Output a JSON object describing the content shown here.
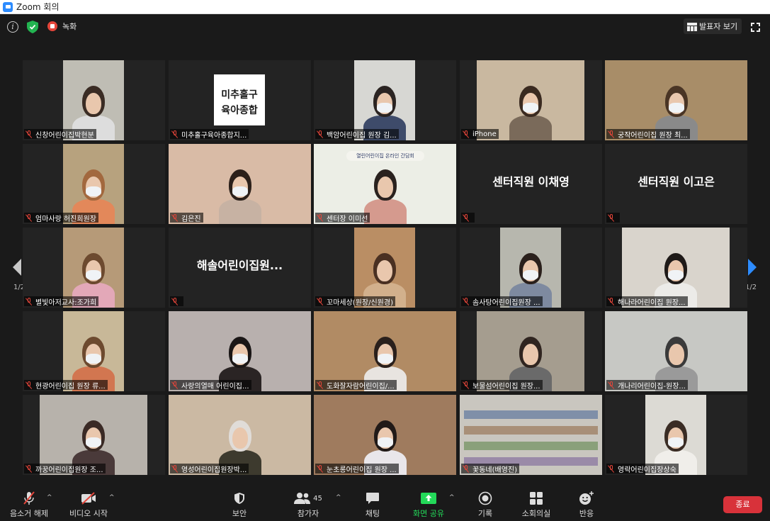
{
  "window": {
    "title": "Zoom 회의"
  },
  "topbar": {
    "recording_label": "녹화",
    "view_button_label": "발표자 보기"
  },
  "gallery": {
    "page_indicator_left": "1/2",
    "page_indicator_right": "1/2",
    "tiles": [
      {
        "name": "신창어린이집박현분"
      },
      {
        "name": "미추홀구육아종합지..."
      },
      {
        "name": "백암어린이집 원장 김..."
      },
      {
        "name": "iPhone"
      },
      {
        "name": "궁작어린이집 원장 최..."
      },
      {
        "name": "엄마사랑 허진희원장"
      },
      {
        "name": "김은진"
      },
      {
        "name": "센터장 이미선"
      },
      {
        "name": "",
        "display_name": "센터직원 이채영"
      },
      {
        "name": "",
        "display_name": "센터직원 이고은"
      },
      {
        "name": "별빛아저교사:조가희"
      },
      {
        "name": "",
        "display_name": "해솔어린이집원..."
      },
      {
        "name": "꼬마세상(원장/신원경)"
      },
      {
        "name": "솜사탕어린이집원장 ..."
      },
      {
        "name": "해나라어린이집 원장..."
      },
      {
        "name": "현광어린이집 원장 류..."
      },
      {
        "name": "사랑의열매 어린이집..."
      },
      {
        "name": "도화잘자람어린이집/..."
      },
      {
        "name": "보물섬어린이집 원장..."
      },
      {
        "name": "개나리어린이집-원장..."
      },
      {
        "name": "까꿍어린이집원장 조..."
      },
      {
        "name": "영성어린이집원장박..."
      },
      {
        "name": "눈초롱어린이집 원장 ..."
      },
      {
        "name": "꽃동네(배영진)"
      },
      {
        "name": "영락어린이집장상숙"
      }
    ],
    "logo_lines": [
      "미추홀구",
      "육아종합"
    ],
    "banner_text": "열린어린이집 온라인 간담회"
  },
  "toolbar": {
    "unmute_label": "음소거 해제",
    "start_video_label": "비디오 시작",
    "security_label": "보안",
    "participants_label": "참가자",
    "participants_count": "45",
    "chat_label": "채팅",
    "share_label": "화면 공유",
    "record_label": "기록",
    "breakout_label": "소회의실",
    "reactions_label": "반응",
    "end_label": "종료"
  },
  "colors": {
    "active_speaker": "#d7e56b",
    "share_green": "#23d959",
    "end_red": "#d8323a",
    "muted_red": "#e4453a",
    "arrow_blue": "#2d8cff"
  }
}
